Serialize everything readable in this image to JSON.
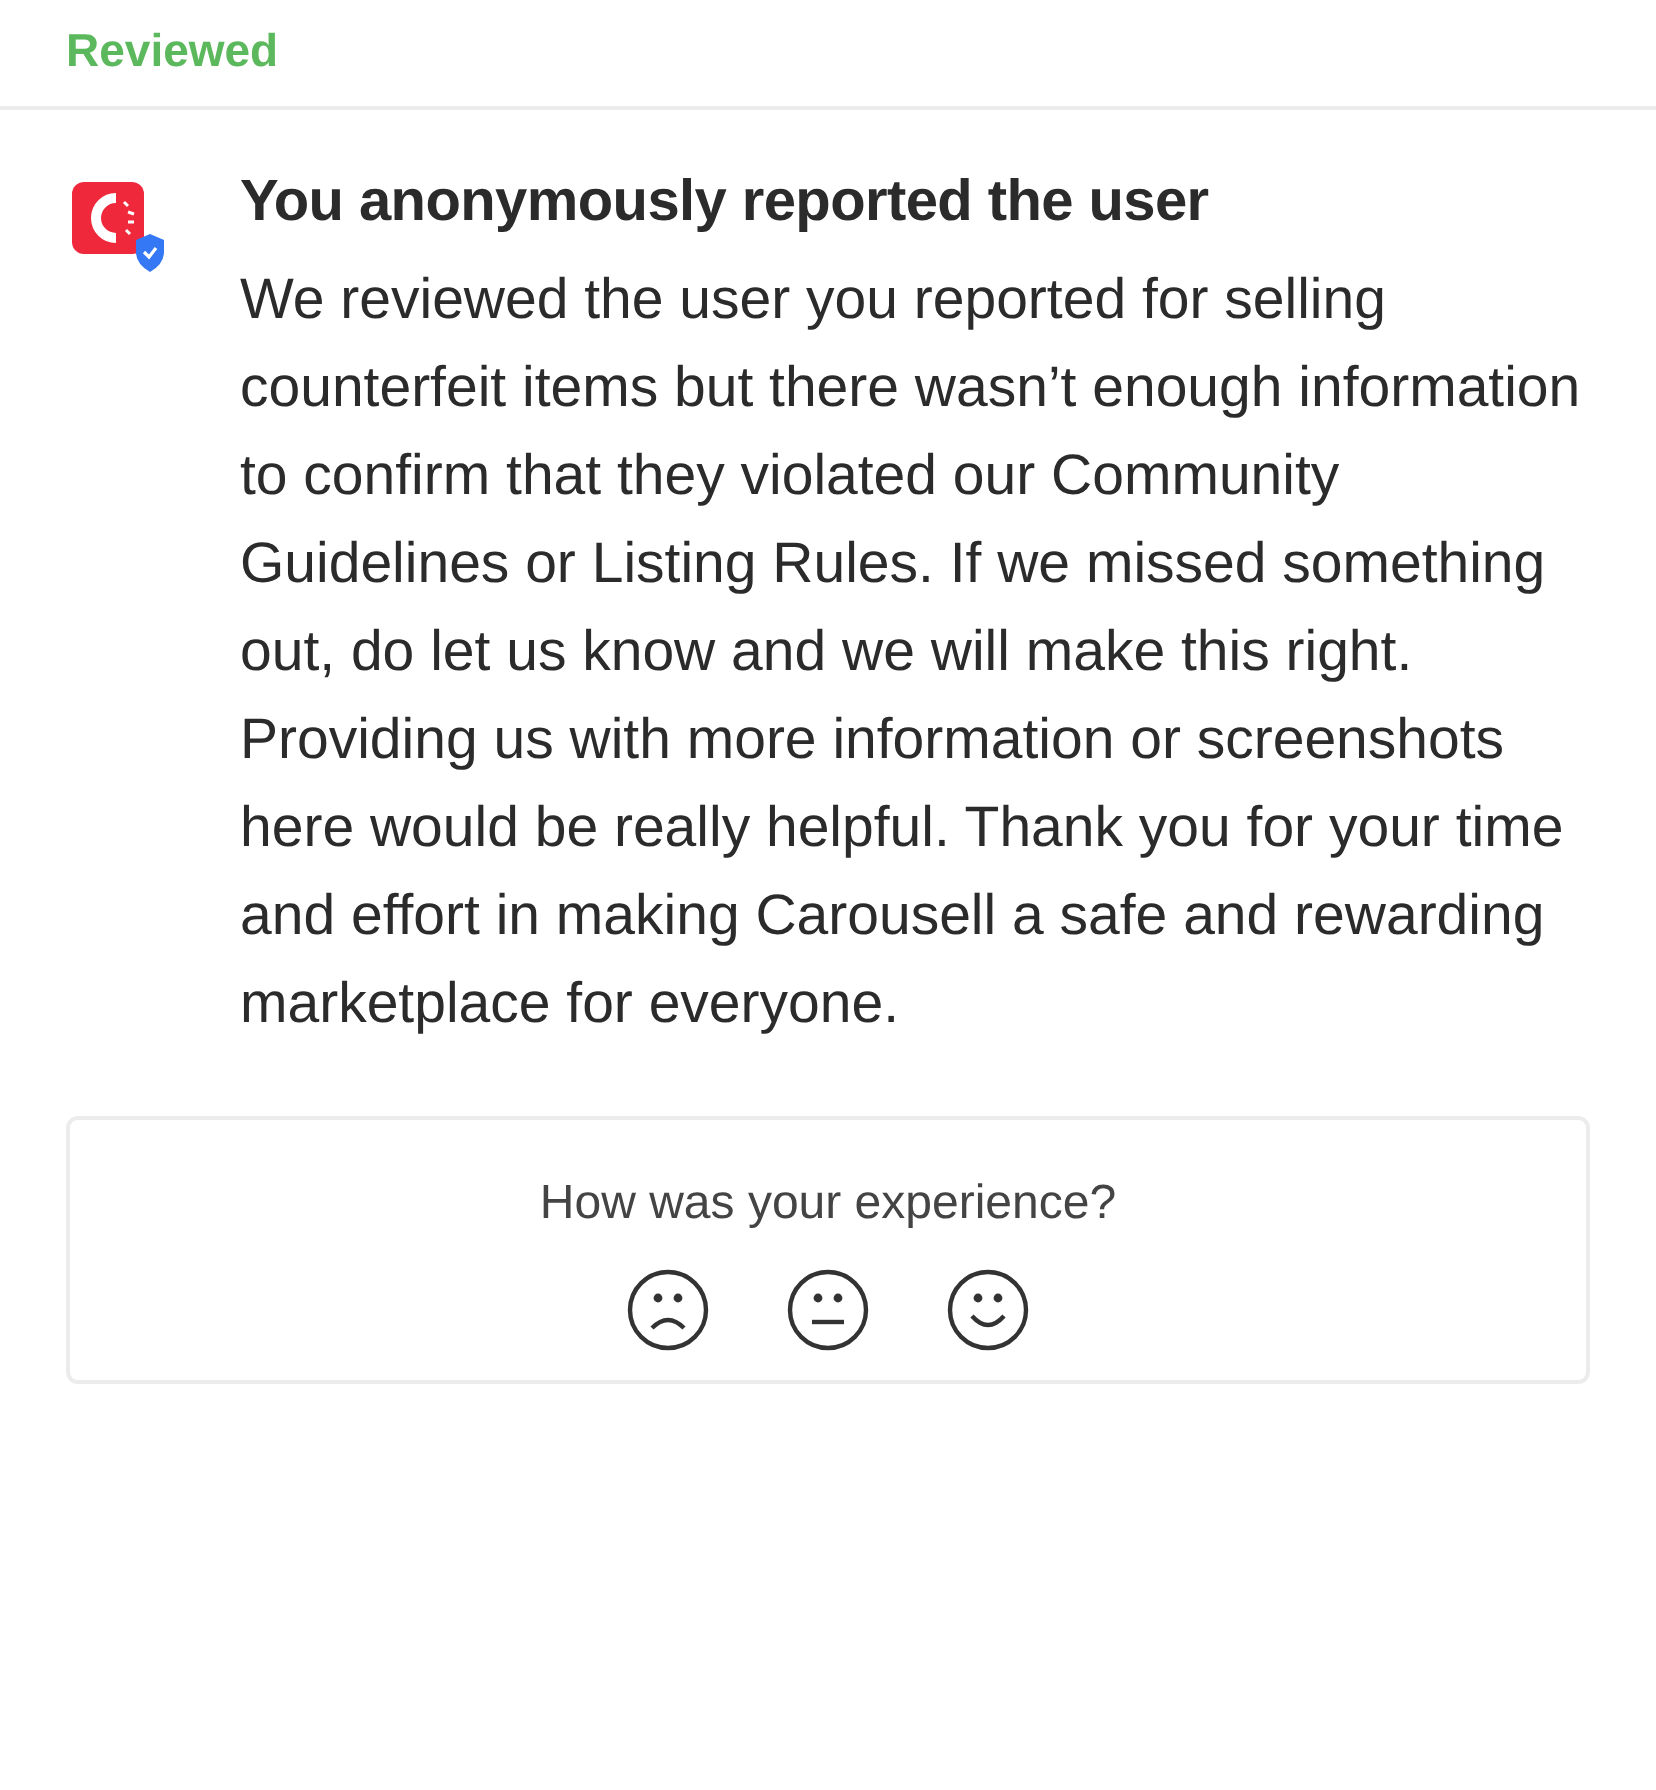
{
  "status": "Reviewed",
  "notification": {
    "title": "You anonymously reported the user",
    "body": "We reviewed the user you reported for selling counterfeit items but there wasn’t enough information to confirm that they violated our Community Guidelines or Listing Rules. If we missed something out, do let us know and we will make this right. Providing us with more information or screenshots here would be really helpful. Thank you for your time and effort in making Carousell a safe and rewarding marketplace for everyone."
  },
  "feedback": {
    "question": "How was your experience?",
    "options": [
      {
        "kind": "sad"
      },
      {
        "kind": "neutral"
      },
      {
        "kind": "happy"
      }
    ]
  }
}
